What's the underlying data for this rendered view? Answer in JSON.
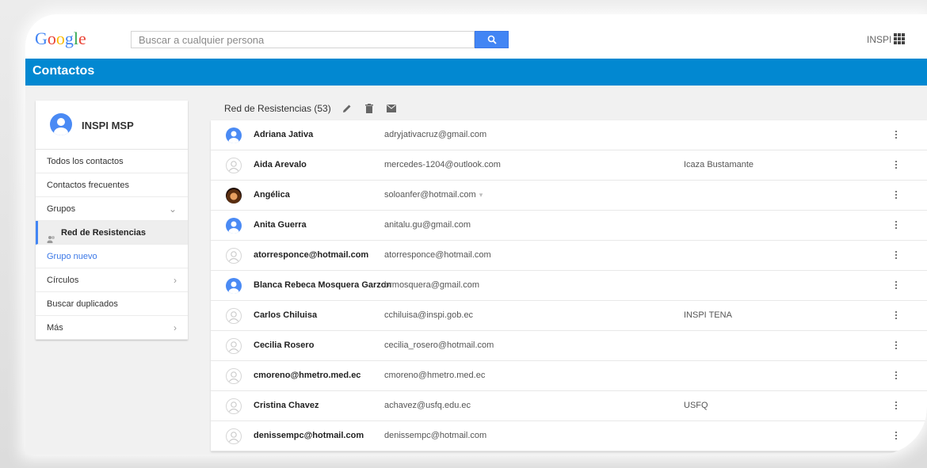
{
  "topbar": {
    "logo_letters": [
      "G",
      "o",
      "o",
      "g",
      "l",
      "e"
    ],
    "search_placeholder": "Buscar a cualquier persona",
    "user_label": "INSPI",
    "search_icon": "search-icon",
    "apps_icon": "apps-grid-icon"
  },
  "appbar": {
    "title": "Contactos",
    "color": "#0288d1"
  },
  "sidebar": {
    "account_name": "INSPI MSP",
    "items": [
      {
        "label": "Todos los contactos"
      },
      {
        "label": "Contactos frecuentes"
      },
      {
        "label": "Grupos",
        "arrow": "⌄"
      },
      {
        "label": "Red de Resistencias",
        "icon": "group-icon",
        "active": true
      },
      {
        "label": "Grupo nuevo",
        "link": true
      },
      {
        "label": "Círculos",
        "arrow": "›"
      },
      {
        "label": "Buscar duplicados"
      },
      {
        "label": "Más",
        "arrow": "›"
      }
    ]
  },
  "list_header": {
    "title": "Red de Resistencias (53)",
    "edit_icon": "pencil-icon",
    "delete_icon": "trash-icon",
    "mail_icon": "mail-icon"
  },
  "contacts": [
    {
      "name": "Adriana Jativa",
      "email": "adryjativacruz@gmail.com",
      "org": "",
      "avatar": "blue"
    },
    {
      "name": "Aida Arevalo",
      "email": "mercedes-1204@outlook.com",
      "org": "Icaza Bustamante",
      "avatar": "gray"
    },
    {
      "name": "Angélica",
      "email": "soloanfer@hotmail.com",
      "org": "",
      "avatar": "photo",
      "email_dropdown": "▾"
    },
    {
      "name": "Anita Guerra",
      "email": "anitalu.gu@gmail.com",
      "org": "",
      "avatar": "blue"
    },
    {
      "name": "atorresponce@hotmail.com",
      "email": "atorresponce@hotmail.com",
      "org": "",
      "avatar": "gray"
    },
    {
      "name": "Blanca Rebeca Mosquera Garzon",
      "email": "brmosquera@gmail.com",
      "org": "",
      "avatar": "blue"
    },
    {
      "name": "Carlos Chiluisa",
      "email": "cchiluisa@inspi.gob.ec",
      "org": "INSPI TENA",
      "avatar": "gray"
    },
    {
      "name": "Cecilia Rosero",
      "email": "cecilia_rosero@hotmail.com",
      "org": "",
      "avatar": "gray"
    },
    {
      "name": "cmoreno@hmetro.med.ec",
      "email": "cmoreno@hmetro.med.ec",
      "org": "",
      "avatar": "gray"
    },
    {
      "name": "Cristina Chavez",
      "email": "achavez@usfq.edu.ec",
      "org": "USFQ",
      "avatar": "gray"
    },
    {
      "name": "denissempc@hotmail.com",
      "email": "denissempc@hotmail.com",
      "org": "",
      "avatar": "gray"
    }
  ]
}
